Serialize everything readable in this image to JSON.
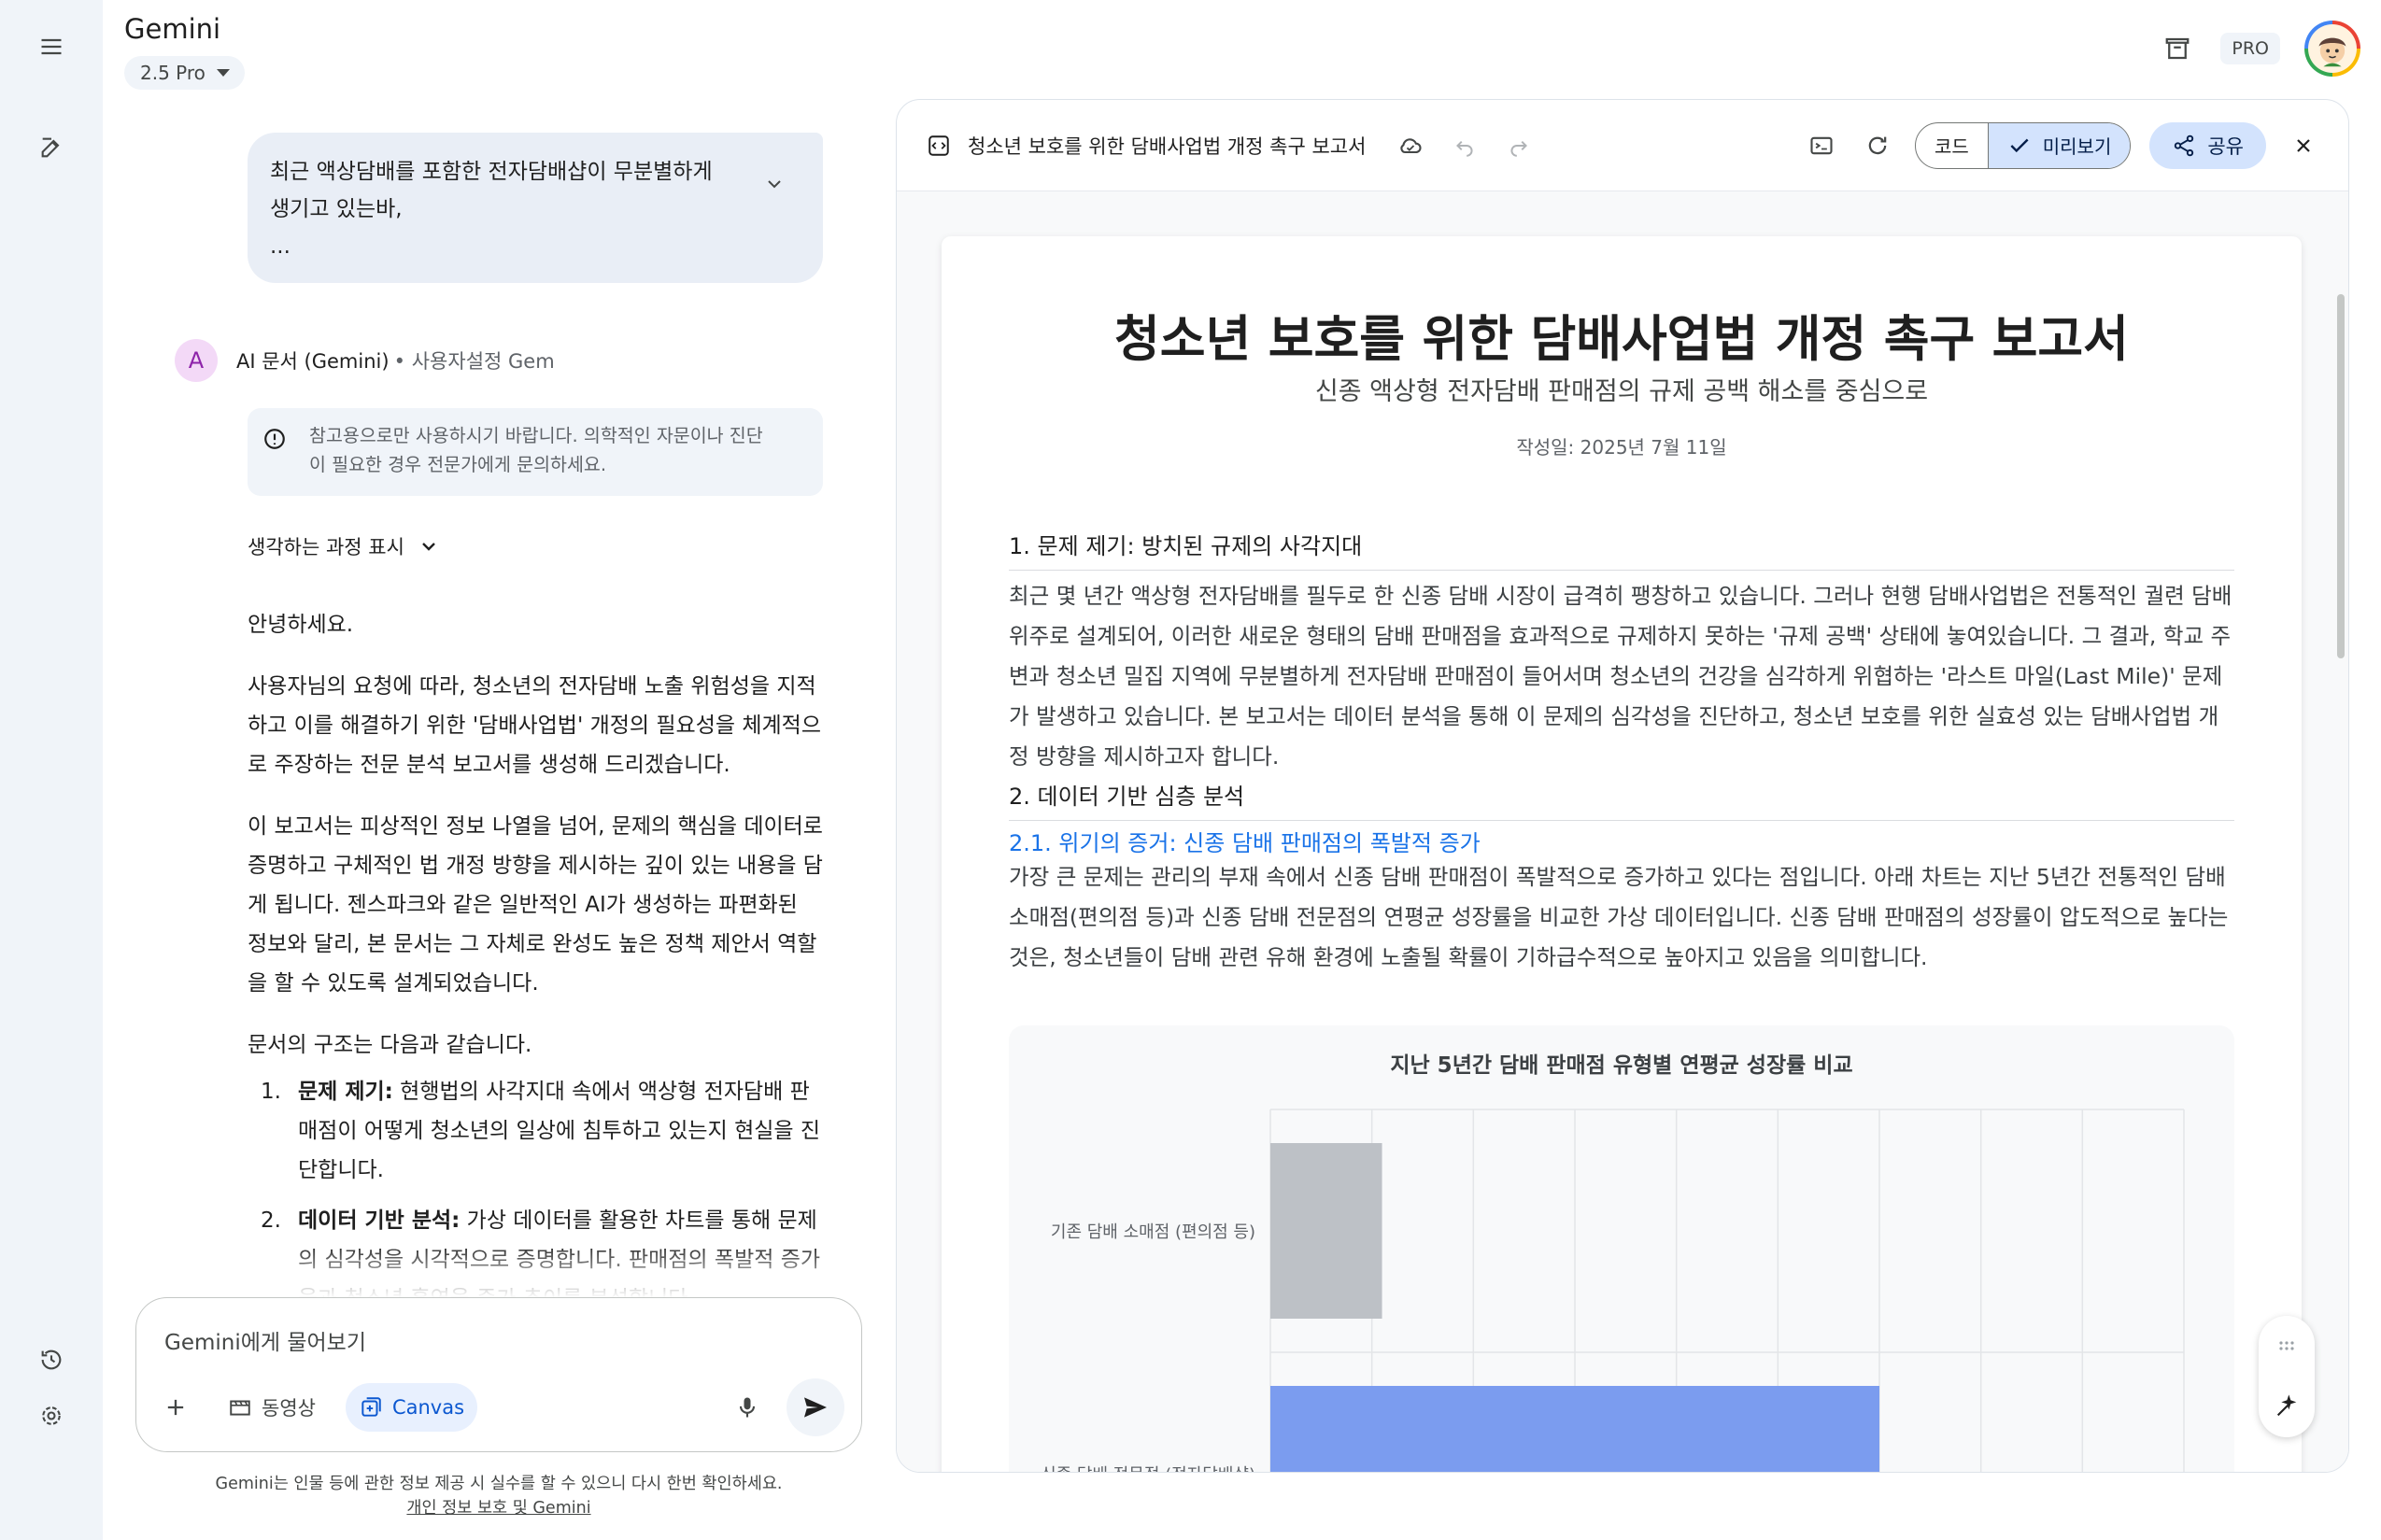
{
  "app": {
    "title": "Gemini",
    "model": "2.5 Pro",
    "pro_badge": "PRO"
  },
  "chat": {
    "user_message": [
      "최근 액상담배를 포함한 전자담배샵이 무분별하게",
      "생기고 있는바,",
      "..."
    ],
    "ai_name": "AI 문서 (Gemini)",
    "ai_sub": "• 사용자설정 Gem",
    "disclaimer": [
      "참고용으로만 사용하시기 바랍니다. 의학적인 자문이나 진단",
      "이 필요한 경우 전문가에게 문의하세요."
    ],
    "thinking_label": "생각하는 과정 표시",
    "paragraphs": [
      "안녕하세요.",
      "사용자님의 요청에 따라, 청소년의 전자담배 노출 위험성을 지적하고 이를 해결하기 위한 '담배사업법' 개정의 필요성을 체계적으로 주장하는 전문 분석 보고서를 생성해 드리겠습니다.",
      "이 보고서는 피상적인 정보 나열을 넘어, 문제의 핵심을 데이터로 증명하고 구체적인 법 개정 방향을 제시하는 깊이 있는 내용을 담게 됩니다. 젠스파크와 같은 일반적인 AI가 생성하는 파편화된 정보와 달리, 본 문서는 그 자체로 완성도 높은 정책 제안서 역할을 할 수 있도록 설계되었습니다.",
      "문서의 구조는 다음과 같습니다."
    ],
    "list": [
      {
        "num": "1.",
        "bold": "문제 제기:",
        "text": " 현행법의 사각지대 속에서 액상형 전자담배 판매점이 어떻게 청소년의 일상에 침투하고 있는지 현실을 진단합니다."
      },
      {
        "num": "2.",
        "bold": "데이터 기반 분석:",
        "text": " 가상 데이터를 활용한 차트를 통해 문제의 심각성을 시각적으로 증명합니다. 판매점의 폭발적 증가율과 청소년 흡연율 증가 추이를 분석합니다."
      }
    ]
  },
  "input": {
    "placeholder": "Gemini에게 물어보기",
    "video_label": "동영상",
    "canvas_label": "Canvas"
  },
  "footer": {
    "note": "Gemini는 인물 등에 관한 정보 제공 시 실수를 할 수 있으니 다시 한번 확인하세요.",
    "link": "개인 정보 보호 및 Gemini"
  },
  "panel": {
    "title": "청소년 보호를 위한 담배사업법 개정 촉구 보고서",
    "code_label": "코드",
    "preview_label": "미리보기",
    "share_label": "공유"
  },
  "doc": {
    "title": "청소년 보호를 위한 담배사업법 개정 촉구 보고서",
    "subtitle": "신종 액상형 전자담배 판매점의 규제 공백 해소를 중심으로",
    "date": "작성일: 2025년 7월 11일",
    "s1_heading": "1. 문제 제기: 방치된 규제의 사각지대",
    "s1_body": "최근 몇 년간 액상형 전자담배를 필두로 한 신종 담배 시장이 급격히 팽창하고 있습니다. 그러나 현행 담배사업법은 전통적인 궐련 담배 위주로 설계되어, 이러한 새로운 형태의 담배 판매점을 효과적으로 규제하지 못하는 '규제 공백' 상태에 놓여있습니다. 그 결과, 학교 주변과 청소년 밀집 지역에 무분별하게 전자담배 판매점이 들어서며 청소년의 건강을 심각하게 위협하는 '라스트 마일(Last Mile)' 문제가 발생하고 있습니다. 본 보고서는 데이터 분석을 통해 이 문제의 심각성을 진단하고, 청소년 보호를 위한 실효성 있는 담배사업법 개정 방향을 제시하고자 합니다.",
    "s2_heading": "2. 데이터 기반 심층 분석",
    "s21_heading": "2.1. 위기의 증거: 신종 담배 판매점의 폭발적 증가",
    "s21_body": "가장 큰 문제는 관리의 부재 속에서 신종 담배 판매점이 폭발적으로 증가하고 있다는 점입니다. 아래 차트는 지난 5년간 전통적인 담배 소매점(편의점 등)과 신종 담배 전문점의 연평균 성장률을 비교한 가상 데이터입니다. 신종 담배 판매점의 성장률이 압도적으로 높다는 것은, 청소년들이 담배 관련 유해 환경에 노출될 확률이 기하급수적으로 높아지고 있음을 의미합니다."
  },
  "chart_data": {
    "type": "bar",
    "orientation": "horizontal",
    "title": "지난 5년간 담배 판매점 유형별 연평균 성장률 비교",
    "categories": [
      "기존 담배 소매점 (편의점 등)",
      "신종 담배 전문점 (전자담배샵)"
    ],
    "values": [
      1.1,
      6.0
    ],
    "colors": [
      "#bdc1c6",
      "#7b9cef"
    ],
    "xlim": [
      0,
      9
    ],
    "grid": true,
    "legend": "none"
  }
}
